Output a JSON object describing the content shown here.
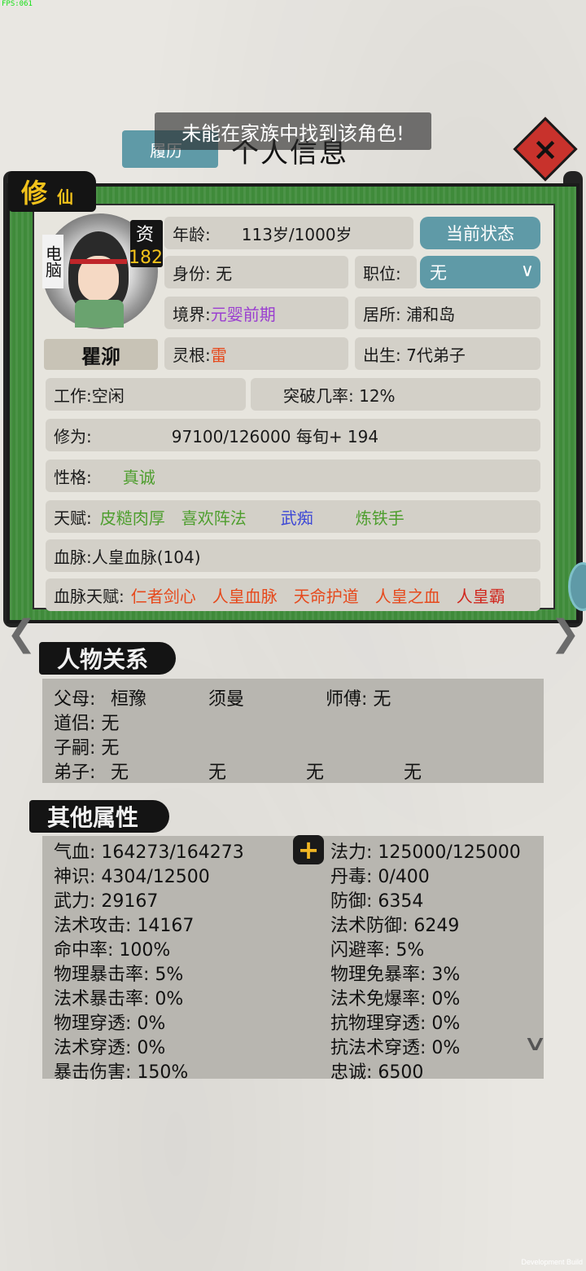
{
  "fps": "FPS:061",
  "dev_build": "Development Build",
  "header": {
    "tab_resume": "履历",
    "title": "个人信息",
    "toast": "未能在家族中找到该角色!",
    "close_icon": "×"
  },
  "badge": {
    "xiu": "修",
    "xian": "仙"
  },
  "character": {
    "controller_tag": "电脑",
    "aptitude_label": "资",
    "aptitude_value": "182",
    "name": "瞿泖"
  },
  "info": {
    "age_label": "年龄:",
    "age_value": "113岁/1000岁",
    "state_button": "当前状态",
    "identity": "身份: 无",
    "position_label": "职位:",
    "position_value": "无",
    "realm_label": "境界:",
    "realm_value": "元婴前期",
    "residence": "居所:  浦和岛",
    "root_label": "灵根:",
    "root_value": "雷",
    "birth": "出生: 7代弟子",
    "work": "工作:空闲",
    "breakthrough": "突破几率: 12%",
    "cultivation_label": "修为:",
    "cultivation_value": "97100/126000  每旬+ 194",
    "personality_label": "性格:",
    "personality_value": "真诚",
    "talent_label": "天赋:",
    "talents": [
      "皮糙肉厚",
      "喜欢阵法",
      "武痴",
      "炼铁手"
    ],
    "bloodline": "血脉:人皇血脉(104)",
    "bloodline_talent_label": "血脉天赋:",
    "bloodline_talents": [
      "仁者剑心",
      "人皇血脉",
      "天命护道",
      "人皇之血",
      "人皇霸"
    ]
  },
  "relations": {
    "title": "人物关系",
    "parents_label": "父母:",
    "parent1": "桓豫",
    "parent2": "须曼",
    "master": "师傅: 无",
    "partner": "道侣: 无",
    "heir": "子嗣: 无",
    "disciples_label": "弟子:",
    "disciples": [
      "无",
      "无",
      "无",
      "无"
    ]
  },
  "attributes": {
    "title": "其他属性",
    "left": [
      "气血: 164273/164273",
      "神识: 4304/12500",
      "武力: 29167",
      "法术攻击: 14167",
      "命中率: 100%",
      "物理暴击率:  5%",
      "法术暴击率:  0%",
      "物理穿透: 0%",
      "法术穿透: 0%",
      "暴击伤害: 150%"
    ],
    "right": [
      "法力: 125000/125000",
      "丹毒: 0/400",
      "防御: 6354",
      "法术防御: 6249",
      "闪避率:  5%",
      "物理免暴率:  3%",
      "法术免爆率:  0%",
      "抗物理穿透:  0%",
      "抗法术穿透:  0%",
      "忠诚:   6500"
    ]
  },
  "colors": {
    "frame_green": "#3f8b3a",
    "button_teal": "#5f9aa7",
    "realm_purple": "#9a3ed0",
    "root_orange": "#e6491c",
    "talent_green": "#4e9e2e",
    "talent_blue": "#3b46d6"
  }
}
